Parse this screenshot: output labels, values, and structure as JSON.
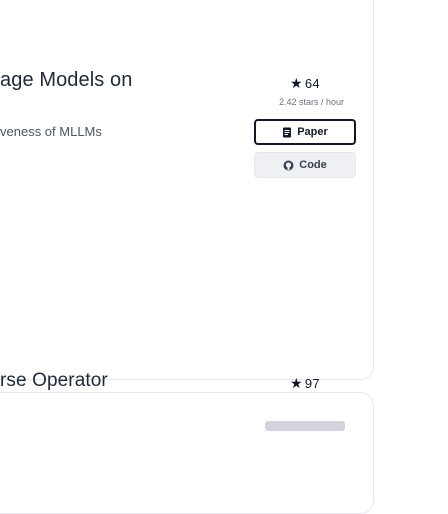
{
  "papers": [
    {
      "title_fragment": "age Models on",
      "stars": "64",
      "star_rate": "2.42 stars / hour"
    },
    {
      "title_fragment": "veness of MLLMs",
      "buttons": {
        "paper": "Paper",
        "code": "Code"
      }
    },
    {
      "title_fragment": "rse Operator",
      "stars": "97"
    }
  ],
  "colors": {
    "star": "#111827",
    "paper_border": "#111827",
    "code_bg": "#eef0f3"
  },
  "icons": {
    "star": "star-icon",
    "paper": "document-icon",
    "code": "github-icon"
  }
}
